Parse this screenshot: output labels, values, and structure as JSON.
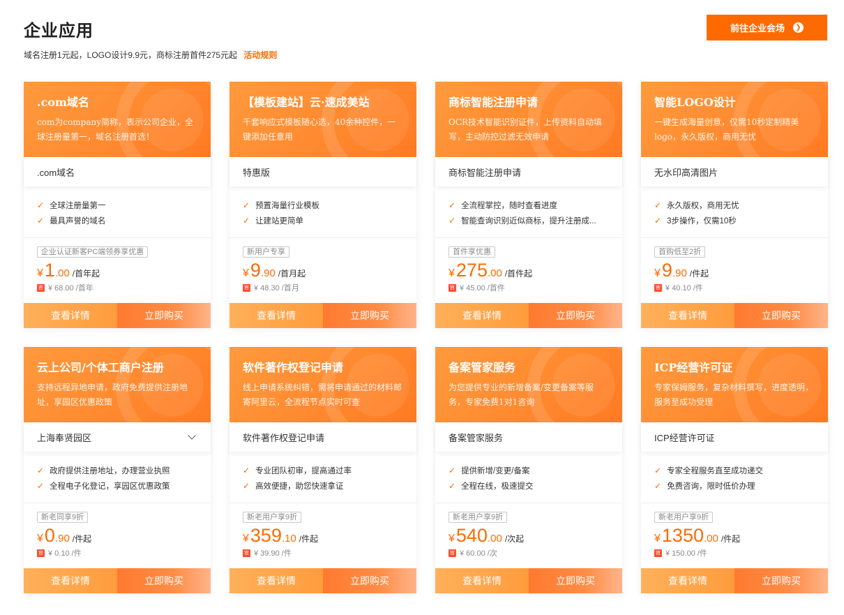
{
  "header": {
    "title": "企业应用",
    "subtitle": "域名注册1元起，LOGO设计9.9元，商标注册首件275元起",
    "rules_link": "活动规则",
    "venue_button": "前往企业会场",
    "venue_button_icon": "arrow-right-circle-icon"
  },
  "colors": {
    "accent": "#ff6a00",
    "card_header": "#ff8a30"
  },
  "cards": [
    {
      "title": ".com域名",
      "desc": "com为company简称，表示公司企业，全球注册量第一，域名注册首选！",
      "spec": ".com域名",
      "has_dropdown": false,
      "features": [
        "全球注册量第一",
        "最具声誉的域名"
      ],
      "promo": "企业认证新客PC端领券享优惠",
      "currency": "¥",
      "price_int": "1",
      "price_dec": ".00",
      "unit": "/首年起",
      "original": "¥ 68.00 /首年",
      "detail_label": "查看详情",
      "buy_label": "立即购买"
    },
    {
      "title": "【模板建站】云·速成美站",
      "desc": "千套响应式模板随心选，40余种控件，一键添加任意用",
      "spec": "特惠版",
      "has_dropdown": false,
      "features": [
        "预置海量行业模板",
        "让建站更简单"
      ],
      "promo": "新用户专享",
      "currency": "¥",
      "price_int": "9",
      "price_dec": ".90",
      "unit": "/首月起",
      "original": "¥ 48.30 /首月",
      "detail_label": "查看详情",
      "buy_label": "立即购买"
    },
    {
      "title": "商标智能注册申请",
      "desc": "OCR技术智能识别证件，上传资料自动填写，主动防控过滤无效申请",
      "spec": "商标智能注册申请",
      "has_dropdown": false,
      "features": [
        "全流程掌控，随时查看进度",
        "智能查询识别近似商标，提升注册成..."
      ],
      "promo": "首件享优惠",
      "currency": "¥",
      "price_int": "275",
      "price_dec": ".00",
      "unit": "/首件起",
      "original": "¥ 45.00 /首件",
      "detail_label": "查看详情",
      "buy_label": "立即购买"
    },
    {
      "title": "智能LOGO设计",
      "desc": "一键生成海量创意，仅需10秒定制精美logo，永久版权，商用无忧",
      "spec": "无水印高清图片",
      "has_dropdown": false,
      "features": [
        "永久版权，商用无忧",
        "3步操作，仅需10秒"
      ],
      "promo": "首购低至2折",
      "currency": "¥",
      "price_int": "9",
      "price_dec": ".90",
      "unit": "/件起",
      "original": "¥ 40.10 /件",
      "detail_label": "查看详情",
      "buy_label": "立即购买"
    },
    {
      "title": "云上公司/个体工商户注册",
      "desc": "支持远程异地申请，政府免费提供注册地址，享园区优惠政策",
      "spec": "上海奉贤园区",
      "has_dropdown": true,
      "features": [
        "政府提供注册地址，办理营业执照",
        "全程电子化登记，享园区优惠政策"
      ],
      "promo": "新老同享9折",
      "currency": "¥",
      "price_int": "0",
      "price_dec": ".90",
      "unit": "/件起",
      "original": "¥ 0.10 /件",
      "detail_label": "查看详情",
      "buy_label": "立即购买"
    },
    {
      "title": "软件著作权登记申请",
      "desc": "线上申请系统纠错，需将申请通过的材料邮寄阿里云，全流程节点实时可查",
      "spec": "软件著作权登记申请",
      "has_dropdown": false,
      "features": [
        "专业团队初审，提高通过率",
        "高效便捷，助您快速拿证"
      ],
      "promo": "新老用户享9折",
      "currency": "¥",
      "price_int": "359",
      "price_dec": ".10",
      "unit": "/件起",
      "original": "¥ 39.90 /件",
      "detail_label": "查看详情",
      "buy_label": "立即购买"
    },
    {
      "title": "备案管家服务",
      "desc": "为您提供专业的新增备案/变更备案等服务，专家免费1对1咨询",
      "spec": "备案管家服务",
      "has_dropdown": false,
      "features": [
        "提供新增/变更/备案",
        "全程在线，极速提交"
      ],
      "promo": "新老用户享9折",
      "currency": "¥",
      "price_int": "540",
      "price_dec": ".00",
      "unit": "/次起",
      "original": "¥ 60.00 /次",
      "detail_label": "查看详情",
      "buy_label": "立即购买"
    },
    {
      "title": "ICP经营许可证",
      "desc": "专家保姆服务，复杂材料撰写，进度透明，服务至成功受理",
      "spec": "ICP经营许可证",
      "has_dropdown": false,
      "features": [
        "专家全程服务直至成功递交",
        "免费咨询，限时低价办理"
      ],
      "promo": "新老用户享9折",
      "currency": "¥",
      "price_int": "1350",
      "price_dec": ".00",
      "unit": "/件起",
      "original": "¥ 150.00 /件",
      "detail_label": "查看详情",
      "buy_label": "立即购买"
    }
  ]
}
